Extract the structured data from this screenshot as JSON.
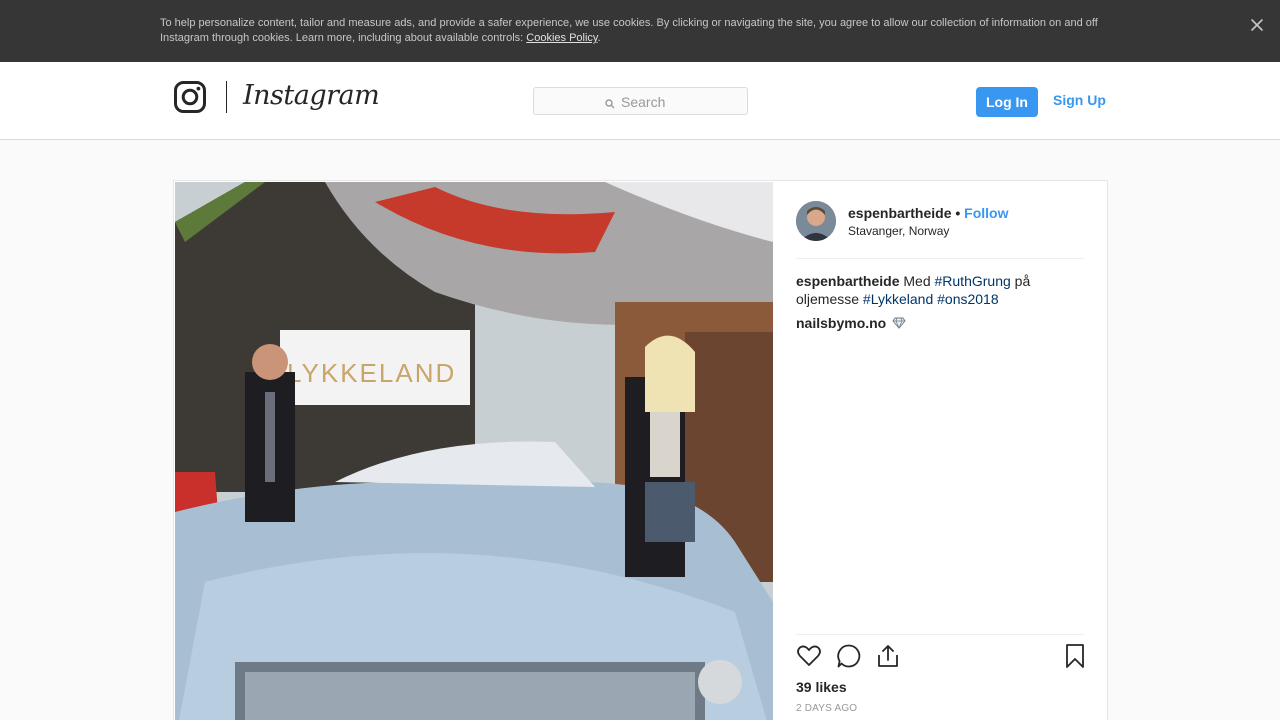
{
  "cookie_banner": {
    "text": "To help personalize content, tailor and measure ads, and provide a safer experience, we use cookies. By clicking or navigating the site, you agree to allow our collection of information on and off Instagram through cookies. Learn more, including about available controls: ",
    "link": "Cookies Policy",
    "period": ".",
    "close_icon": "close-icon"
  },
  "header": {
    "wordmark": "Instagram",
    "search_placeholder": "Search",
    "login": "Log In",
    "signup": "Sign Up"
  },
  "post": {
    "photo_text": "LYKKELAND",
    "username": "espenbartheide",
    "separator": "•",
    "follow": "Follow",
    "location": "Stavanger, Norway",
    "caption": {
      "username": "espenbartheide",
      "text1": "Med",
      "tag1": "#RuthGrung",
      "text2": "på oljemesse",
      "tag2": "#Lykkeland",
      "tag3": "#ons2018"
    },
    "comment": {
      "username": "nailsbymo.no",
      "icon": "gem-icon"
    },
    "likes": "39 likes",
    "time": "2 DAYS AGO"
  },
  "colors": {
    "accent": "#3897f0",
    "hashtag": "#003569",
    "banner": "#363636"
  }
}
